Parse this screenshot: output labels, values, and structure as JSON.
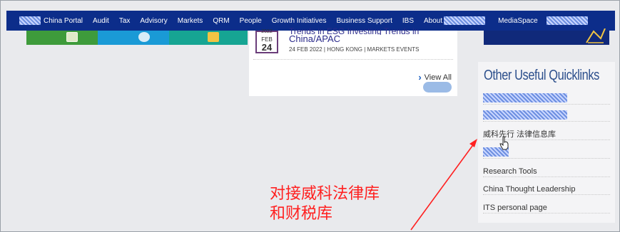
{
  "nav": {
    "items": [
      {
        "label": "China Portal",
        "redacted_prefix": true
      },
      {
        "label": "Audit"
      },
      {
        "label": "Tax"
      },
      {
        "label": "Advisory"
      },
      {
        "label": "Markets"
      },
      {
        "label": "QRM"
      },
      {
        "label": "People"
      },
      {
        "label": "Growth Initiatives"
      },
      {
        "label": "Business Support"
      },
      {
        "label": "IBS"
      },
      {
        "label": "About",
        "redacted_suffix": true
      },
      {
        "label": "MediaSpace",
        "redacted_suffix": true
      }
    ]
  },
  "event": {
    "year": "2022",
    "month": "FEB",
    "day": "24",
    "title_line1": "Trends in ESG Investing Trends in",
    "title": "China/APAC",
    "meta": "24 FEB 2022 | HONG KONG | MARKETS EVENTS",
    "view_all": "View All"
  },
  "quicklinks": {
    "title": "Other Useful Quicklinks",
    "items": [
      {
        "label": "",
        "redacted": true,
        "redact_width": 118
      },
      {
        "label": "",
        "redacted": true,
        "redact_width": 118
      },
      {
        "label": "威科先行 法律信息库",
        "redacted": false
      },
      {
        "label": "",
        "redacted": true,
        "redact_width": 36
      },
      {
        "label": "Research Tools",
        "redacted": false
      },
      {
        "label": "China Thought Leadership",
        "redacted": false
      },
      {
        "label": "ITS personal page",
        "redacted": false
      }
    ]
  },
  "annotation": {
    "line1": "对接威科法律库",
    "line2": "和财税库",
    "color": "#ff2020"
  },
  "colors": {
    "nav_bg": "#0c2d8a",
    "tile_green": "#3e9b3b",
    "tile_blue": "#1a9ad6",
    "tile_teal": "#16a593",
    "banner": "#10297a"
  }
}
